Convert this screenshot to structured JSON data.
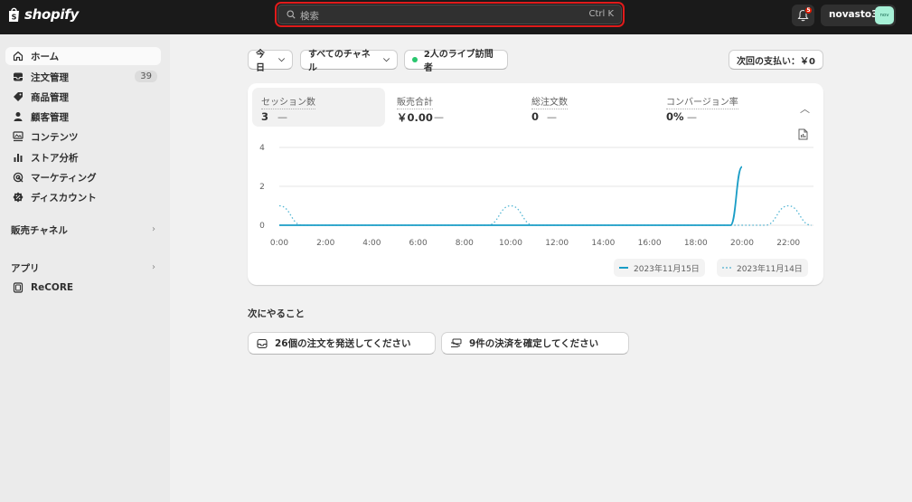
{
  "topbar": {
    "brand": "shopify",
    "search_placeholder": "検索",
    "search_shortcut": "Ctrl K",
    "notification_count": "5",
    "store_name": "novasto3",
    "avatar_initials": "nov"
  },
  "sidebar": {
    "items": [
      {
        "label": "ホーム",
        "icon": "home-icon",
        "active": true
      },
      {
        "label": "注文管理",
        "icon": "inbox-icon",
        "badge": "39"
      },
      {
        "label": "商品管理",
        "icon": "tag-icon"
      },
      {
        "label": "顧客管理",
        "icon": "person-icon"
      },
      {
        "label": "コンテンツ",
        "icon": "content-icon"
      },
      {
        "label": "ストア分析",
        "icon": "bar-chart-icon"
      },
      {
        "label": "マーケティング",
        "icon": "target-icon"
      },
      {
        "label": "ディスカウント",
        "icon": "discount-icon"
      }
    ],
    "sales_channels_label": "販売チャネル",
    "apps_label": "アプリ",
    "app_items": [
      {
        "label": "ReCORE",
        "icon": "app-icon"
      }
    ]
  },
  "filters": {
    "date": "今日",
    "channel": "すべてのチャネル",
    "live_visitors": "2人のライブ訪問者",
    "next_payment": "次回の支払い：￥0"
  },
  "metrics": [
    {
      "label": "セッション数",
      "value": "3",
      "trend": "—"
    },
    {
      "label": "販売合計",
      "value": "￥0.00",
      "trend": "—"
    },
    {
      "label": "総注文数",
      "value": "0",
      "trend": "—"
    },
    {
      "label": "コンバージョン率",
      "value": "0%",
      "trend": "—"
    }
  ],
  "chart_data": {
    "type": "line",
    "x_ticks": [
      "0:00",
      "2:00",
      "4:00",
      "6:00",
      "8:00",
      "10:00",
      "12:00",
      "14:00",
      "16:00",
      "18:00",
      "20:00",
      "22:00"
    ],
    "y_ticks": [
      "0",
      "2",
      "4"
    ],
    "ylim": [
      0,
      4
    ],
    "series": [
      {
        "name": "2023年11月15日",
        "style": "solid",
        "color": "#1a9dc6",
        "x": [
          0,
          1,
          2,
          3,
          4,
          5,
          6,
          7,
          8,
          9,
          10,
          11,
          12,
          13,
          14,
          15,
          16,
          17,
          18,
          19,
          19.5,
          20
        ],
        "y": [
          0,
          0,
          0,
          0,
          0,
          0,
          0,
          0,
          0,
          0,
          0,
          0,
          0,
          0,
          0,
          0,
          0,
          0,
          0,
          0,
          0,
          3
        ]
      },
      {
        "name": "2023年11月14日",
        "style": "dotted",
        "color": "#1a9dc6",
        "x": [
          0,
          1,
          2,
          3,
          4,
          5,
          6,
          7,
          8,
          9,
          10,
          11,
          12,
          13,
          14,
          15,
          16,
          17,
          18,
          19,
          20,
          21,
          22,
          23
        ],
        "y": [
          1,
          0,
          0,
          0,
          0,
          0,
          0,
          0,
          0,
          0,
          1,
          0,
          0,
          0,
          0,
          0,
          0,
          0,
          0,
          0,
          0,
          0,
          1,
          0
        ]
      }
    ]
  },
  "todo": {
    "title": "次にやること",
    "tasks": [
      {
        "label": "26個の注文を発送してください",
        "icon": "inbox-icon"
      },
      {
        "label": "9件の決済を確定してください",
        "icon": "cash-icon"
      }
    ]
  }
}
